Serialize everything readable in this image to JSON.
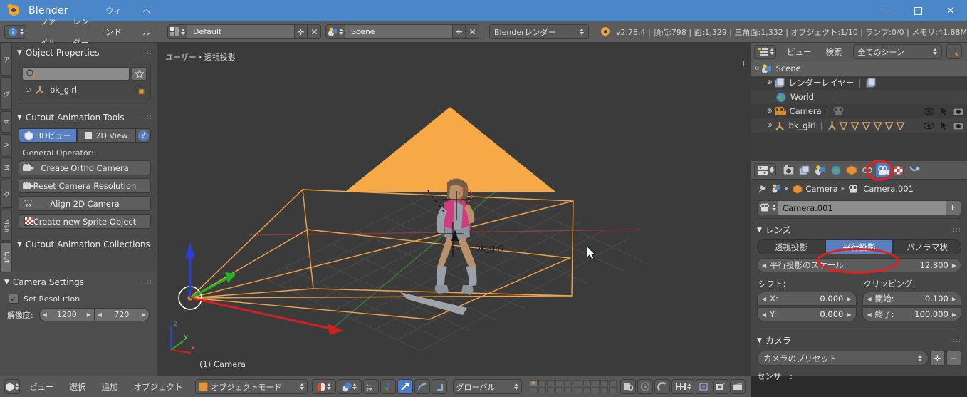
{
  "window": {
    "title": "Blender",
    "minimize": "−",
    "maximize": "□",
    "close": "✕"
  },
  "topbar": {
    "menus": [
      "ファイル",
      "レンダー",
      "ウィンドウ",
      "ヘルプ"
    ],
    "screen_layout": "Default",
    "scene_name": "Scene",
    "add_label": "✛",
    "del_label": "✕",
    "render_engine": "Blenderレンダー",
    "stats": "v2.78.4 | 頂点:798 | 面:1,329 | 三角面:1,332 | オブジェクト:1/10 | ランプ:0/0 | メモリ:41.88M"
  },
  "toolshelf": {
    "tabs": [
      {
        "label": "ア",
        "active": false
      },
      {
        "label": "グ",
        "active": false
      },
      {
        "label": "B",
        "active": false
      },
      {
        "label": "A",
        "active": false
      },
      {
        "label": "M",
        "active": false
      },
      {
        "label": "グ",
        "active": false
      },
      {
        "label": "Man",
        "active": false
      },
      {
        "label": "Cut",
        "active": true
      }
    ],
    "object_properties": {
      "title": "Object Properties",
      "search_placeholder": "",
      "item": "bk_girl"
    },
    "cutout_tools": {
      "title": "Cutout Animation Tools",
      "view_3d": "3Dビュー",
      "view_2d": "2D View",
      "help": "?",
      "general_operator_label": "General Operator:",
      "operators": [
        {
          "label": "Create Ortho Camera",
          "icon": "camera-icon"
        },
        {
          "label": "Reset Camera Resolution",
          "icon": "camera-icon"
        },
        {
          "label": "Align 2D Camera",
          "icon": "arrows-horizontal-icon"
        },
        {
          "label": "Create new Sprite Object",
          "icon": "checker-icon"
        }
      ]
    },
    "collections_title": "Cutout Animation Collections"
  },
  "camera_settings": {
    "title": "Camera Settings",
    "set_resolution_label": "Set Resolution",
    "set_resolution_checked": "✓",
    "resolution_label": "解像度:",
    "resolution_x": "1280",
    "resolution_y": "720"
  },
  "viewport": {
    "view_label": "ユーザー・透視投影",
    "camera_label": "(1) Camera",
    "object_label": "bk_girl",
    "axis_x": "x",
    "axis_y": "y",
    "axis_z": "z",
    "plus_label": "+",
    "frustum_color": "#f5a344",
    "background_color": "#3b3b3b",
    "grid_color": "#4e4e4e"
  },
  "viewport_footer": {
    "menus": [
      "ビュー",
      "選択",
      "追加",
      "オブジェクト"
    ],
    "mode": "オブジェクトモード",
    "transform_orientation": "グローバル"
  },
  "outliner": {
    "view_label": "ビュー",
    "search_label": "検索",
    "display_mode": "全てのシーン",
    "rows": [
      {
        "label": "Scene",
        "depth": 0,
        "icon": "scene-icon",
        "expander": "−"
      },
      {
        "label": "レンダーレイヤー",
        "depth": 1,
        "icon": "renderlayer-icon",
        "expander": "+"
      },
      {
        "label": "World",
        "depth": 1,
        "icon": "world-icon",
        "expander": ""
      },
      {
        "label": "Camera",
        "depth": 1,
        "icon": "camera-icon",
        "expander": "+"
      },
      {
        "label": "bk_girl",
        "depth": 1,
        "icon": "armature-icon",
        "expander": "+"
      }
    ]
  },
  "properties": {
    "tabs": [
      {
        "name": "render-tab",
        "icon": "camera-back-icon",
        "active": false
      },
      {
        "name": "render-layers-tab",
        "icon": "images-icon",
        "active": false
      },
      {
        "name": "scene-tab",
        "icon": "scene-icon",
        "active": false
      },
      {
        "name": "world-tab",
        "icon": "world-icon",
        "active": false
      },
      {
        "name": "object-tab",
        "icon": "cube-icon",
        "active": false
      },
      {
        "name": "constraints-tab",
        "icon": "chain-icon",
        "active": false
      },
      {
        "name": "object-data-tab",
        "icon": "camera-data-icon",
        "active": true
      },
      {
        "name": "texture-tab",
        "icon": "checker-icon",
        "active": false
      },
      {
        "name": "physics-tab",
        "icon": "physics-icon",
        "active": false
      }
    ],
    "breadcrumb": {
      "object": "Camera",
      "data": "Camera.001"
    },
    "datablock_name": "Camera.001",
    "fake_user": "F",
    "lens": {
      "title": "レンズ",
      "types": [
        {
          "label": "透視投影",
          "active": false
        },
        {
          "label": "平行投影",
          "active": true
        },
        {
          "label": "パノラマ状",
          "active": false
        }
      ],
      "ortho_scale_label": "平行投影のスケール:",
      "ortho_scale_value": "12.800",
      "shift_label": "シフト:",
      "shift_x_key": "X:",
      "shift_x_value": "0.000",
      "shift_y_key": "Y:",
      "shift_y_value": "0.000",
      "clipping_label": "クリッピング:",
      "clip_start_key": "開始:",
      "clip_start_value": "0.100",
      "clip_end_key": "終了:",
      "clip_end_value": "100.000"
    },
    "camera": {
      "title": "カメラ",
      "preset_label": "カメラのプリセット",
      "add_preset": "✛",
      "remove_preset": "−",
      "sensor_label": "センサー:"
    }
  },
  "annotations": {
    "highlight_color": "#e81d1d",
    "circles": [
      "properties-object-data-tab",
      "lens-orthographic-button"
    ]
  }
}
